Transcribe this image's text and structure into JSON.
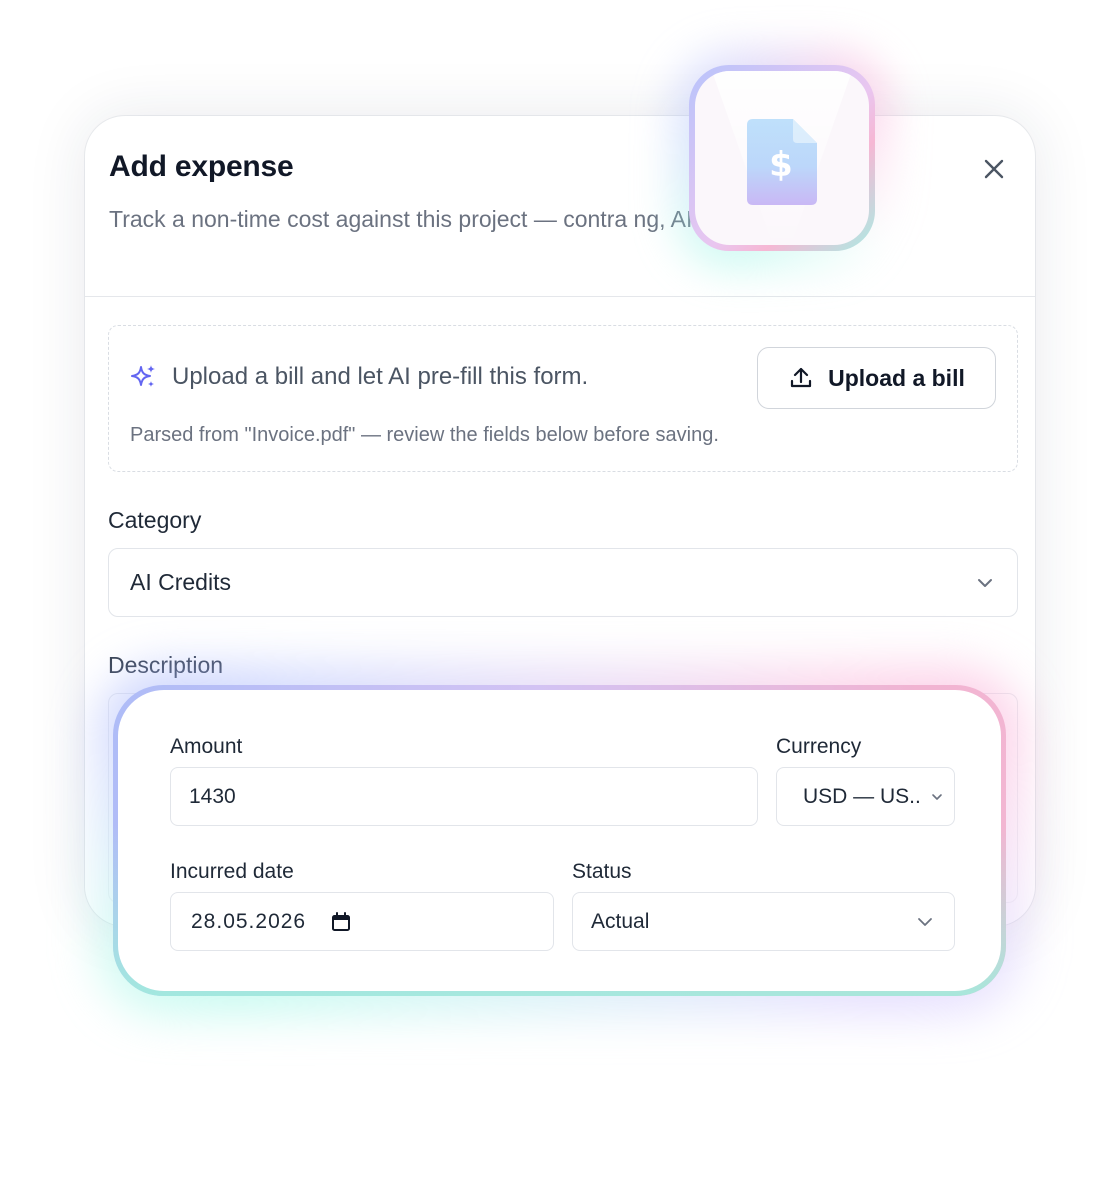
{
  "modal": {
    "title": "Add expense",
    "subtitle": "Track a non-time cost against this project — contra                          ng, AI credits, etc.",
    "close_icon": "close-icon"
  },
  "upload": {
    "prompt": "Upload a bill and let AI pre-fill this form.",
    "button_label": "Upload a bill",
    "parsed_note": "Parsed from \"Invoice.pdf\" — review the fields below before saving.",
    "prompt_icon": "sparkles-icon",
    "button_icon": "upload-icon"
  },
  "category": {
    "label": "Category",
    "value": "AI Credits"
  },
  "description": {
    "label": "Description"
  },
  "form": {
    "amount": {
      "label": "Amount",
      "value": "1430"
    },
    "currency": {
      "label": "Currency",
      "value": "USD — US.."
    },
    "incurred_date": {
      "label": "Incurred date",
      "value": "28.05.2026"
    },
    "status": {
      "label": "Status",
      "value": "Actual"
    }
  },
  "tile": {
    "icon": "dollar-document-icon"
  },
  "colors": {
    "accent_indigo": "#6366f1",
    "doc_blue": "#bfe0fb",
    "doc_purple": "#c9b8f5",
    "text_primary": "#111827",
    "text_muted": "#6b7280",
    "border": "#e2e5ea"
  }
}
